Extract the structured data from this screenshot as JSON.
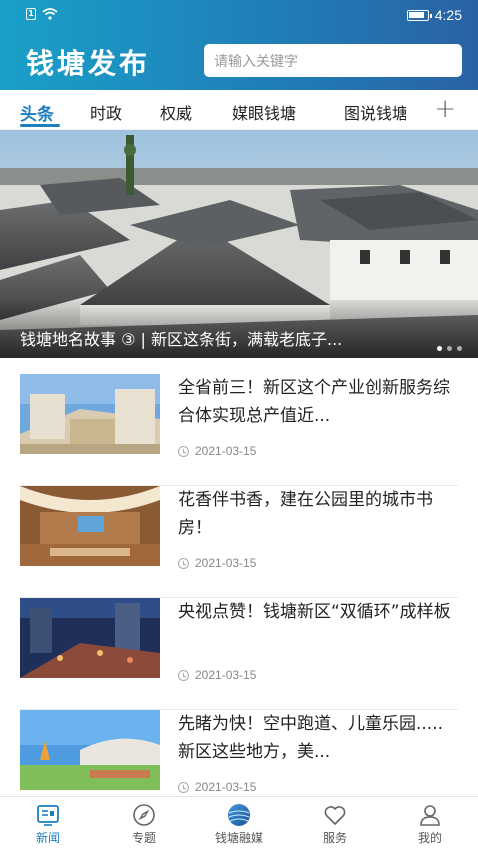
{
  "status_bar": {
    "time": "4:25",
    "sim_label": "1"
  },
  "header": {
    "app_title": "钱塘发布",
    "search_placeholder": "请输入关键字"
  },
  "tabs": [
    {
      "label": "头条",
      "active": true
    },
    {
      "label": "时政",
      "active": false
    },
    {
      "label": "权威",
      "active": false
    },
    {
      "label": "媒眼钱塘",
      "active": false
    },
    {
      "label": "图说钱塘",
      "active": false
    }
  ],
  "tab_add_label": "+",
  "banner": {
    "caption": "钱塘地名故事 ③ | 新区这条街，满载老底子..."
  },
  "news": [
    {
      "title": "全省前三！新区这个产业创新服务综合体实现总产值近...",
      "date": "2021-03-15"
    },
    {
      "title": "花香伴书香，建在公园里的城市书房！",
      "date": "2021-03-15"
    },
    {
      "title": "央视点赞！钱塘新区“双循环”成样板",
      "date": "2021-03-15"
    },
    {
      "title": "先睹为快！空中跑道、儿童乐园.....新区这些地方，美...",
      "date": "2021-03-15"
    }
  ],
  "bottom_nav": [
    {
      "label": "新闻",
      "icon": "news-icon",
      "active": true
    },
    {
      "label": "专题",
      "icon": "compass-icon",
      "active": false
    },
    {
      "label": "钱塘融媒",
      "icon": "globe-logo-icon",
      "active": false
    },
    {
      "label": "服务",
      "icon": "heart-icon",
      "active": false
    },
    {
      "label": "我的",
      "icon": "user-icon",
      "active": false
    }
  ],
  "colors": {
    "accent": "#1c7fc0",
    "header_start": "#1aa0c8",
    "header_end": "#2a62a4"
  }
}
